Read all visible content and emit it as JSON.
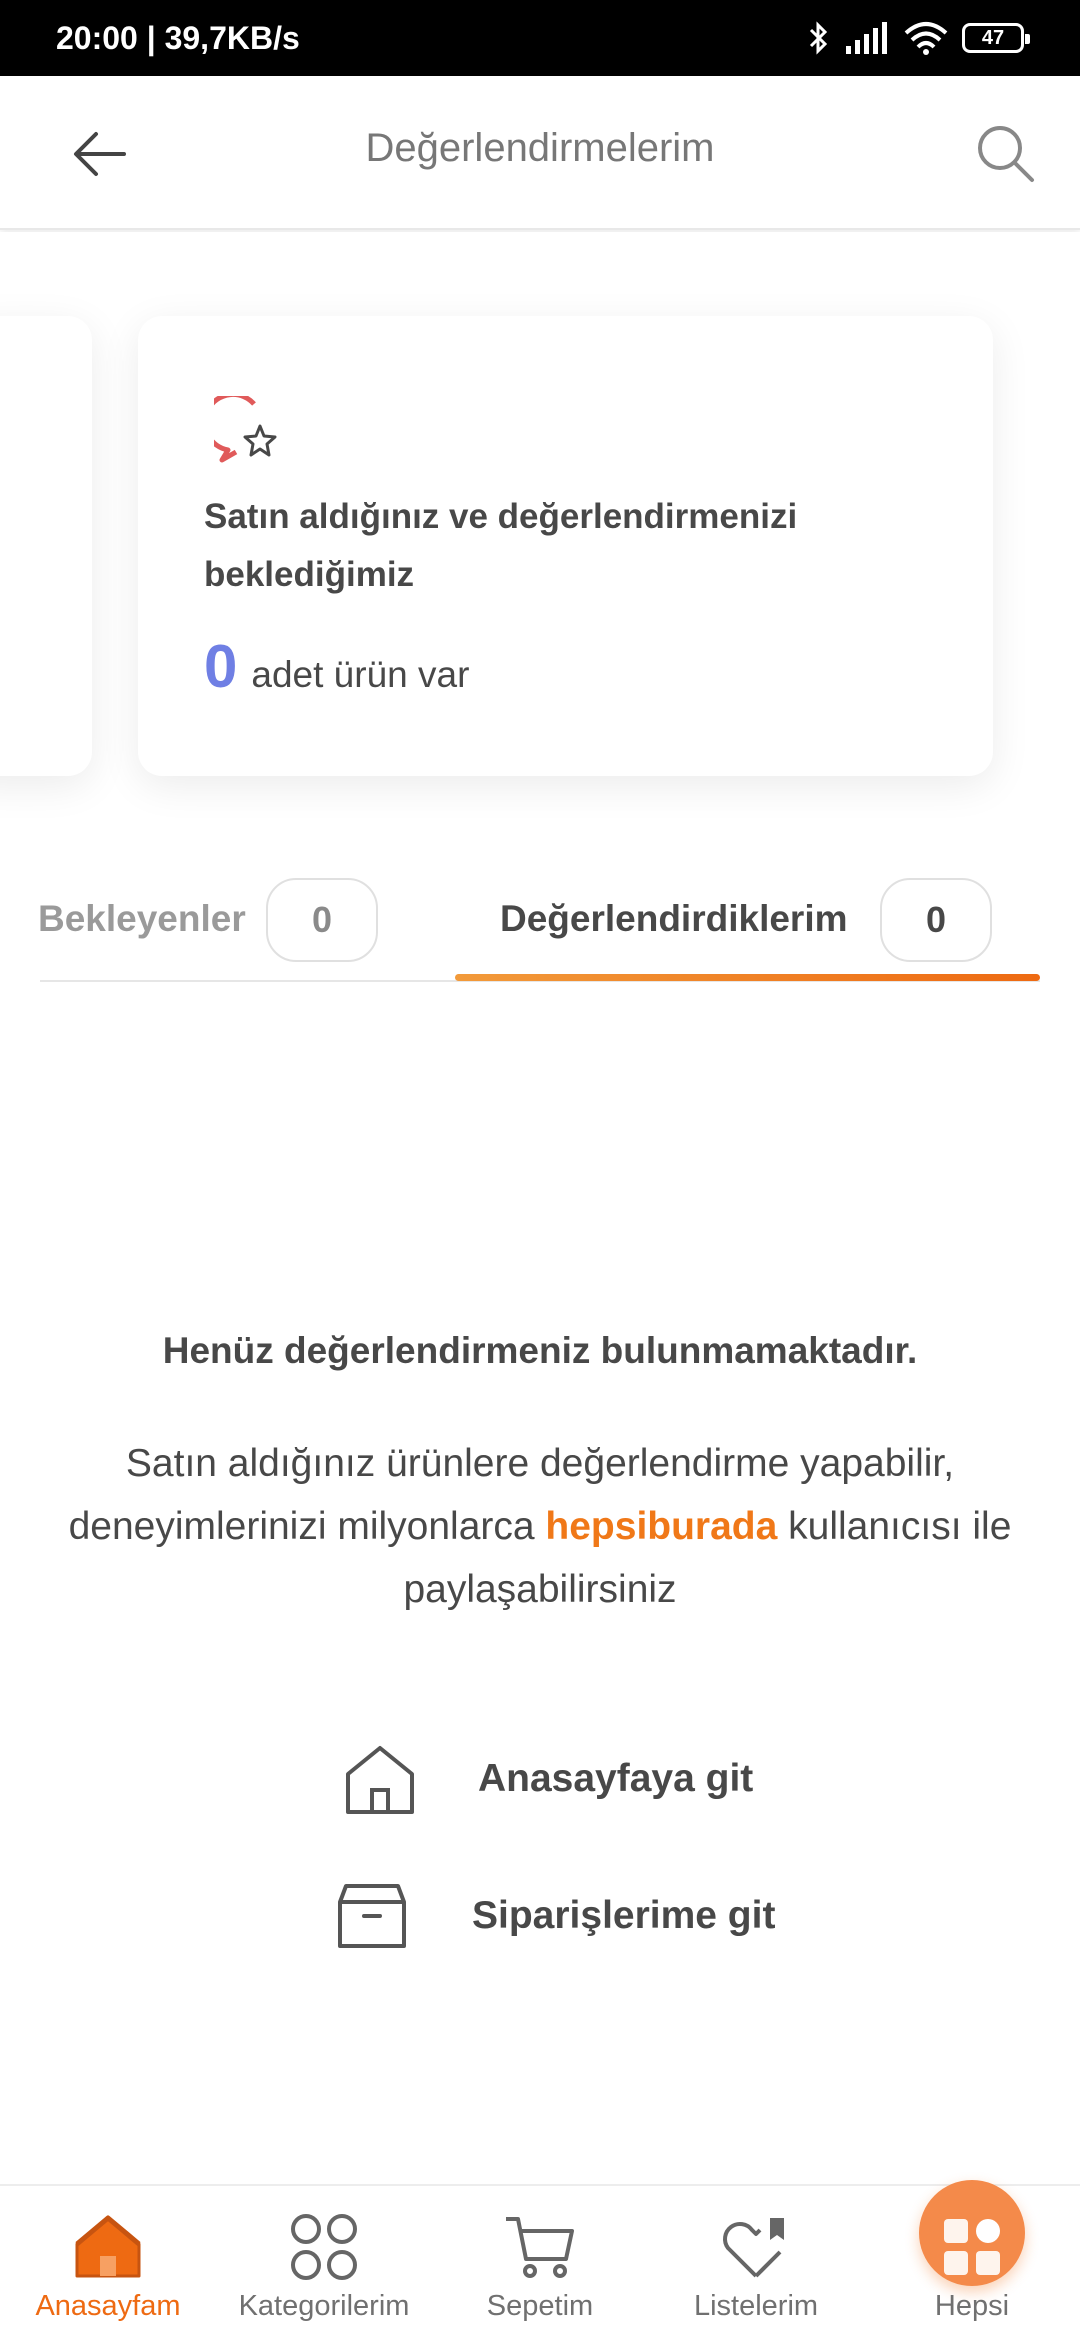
{
  "status_bar": {
    "time_speed": "20:00 | 39,7KB/s",
    "battery": "47"
  },
  "header": {
    "title": "Değerlendirmelerim"
  },
  "summary_card": {
    "text": "Satın aldığınız ve değerlendirmenizi beklediğimiz",
    "count": "0",
    "count_label": "adet ürün var"
  },
  "tabs": [
    {
      "label": "Bekleyenler",
      "count": "0"
    },
    {
      "label": "Değerlendirdiklerim",
      "count": "0"
    }
  ],
  "empty_state": {
    "title": "Henüz değerlendirmeniz bulunmamaktadır.",
    "desc_part1": "Satın aldığınız ürünlere değerlendirme yapabilir, deneyimlerinizi milyonlarca ",
    "desc_brand": "hepsiburada",
    "desc_part2": " kullanıcısı ile paylaşabilirsiniz"
  },
  "actions": {
    "home": "Anasayfaya git",
    "orders": "Siparişlerime git"
  },
  "bottom_nav": [
    {
      "label": "Anasayfam",
      "icon": "home-icon"
    },
    {
      "label": "Kategorilerim",
      "icon": "categories-icon"
    },
    {
      "label": "Sepetim",
      "icon": "cart-icon"
    },
    {
      "label": "Listelerim",
      "icon": "lists-heart-icon"
    },
    {
      "label": "Hepsi",
      "icon": "hepsi-grid-icon"
    }
  ],
  "colors": {
    "accent": "#ee6a12",
    "count": "#6f7fe4"
  }
}
